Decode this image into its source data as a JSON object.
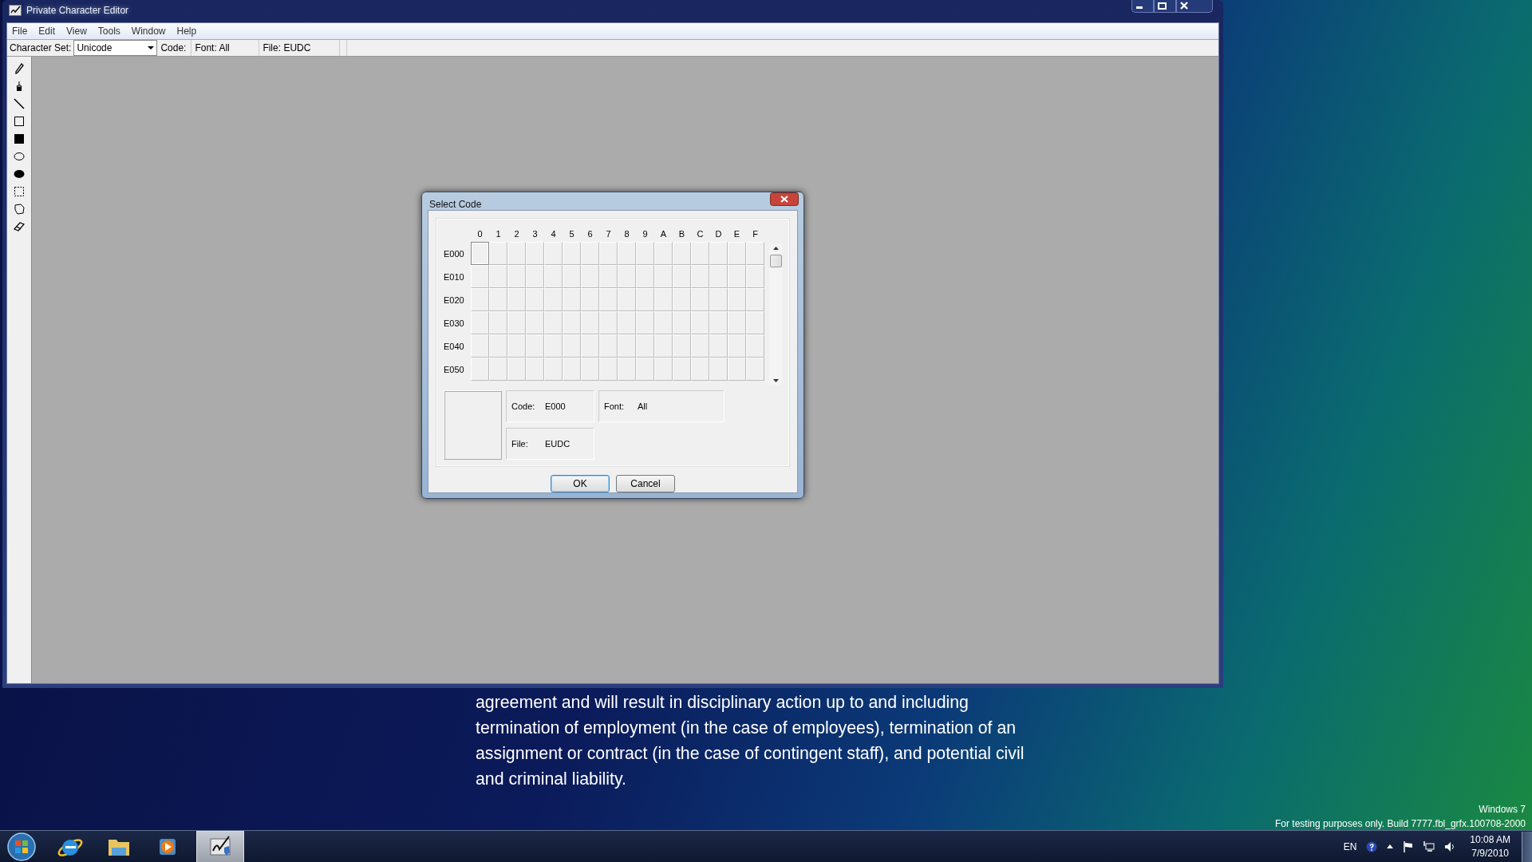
{
  "window": {
    "title": "Private Character Editor",
    "controls": [
      {
        "kind": "minimize"
      },
      {
        "kind": "maximize"
      },
      {
        "kind": "close"
      }
    ]
  },
  "menu": [
    "File",
    "Edit",
    "View",
    "Tools",
    "Window",
    "Help"
  ],
  "toolbar": {
    "charset_label": "Character Set:",
    "charset_value": "Unicode",
    "code": "Code:",
    "font": "Font: All",
    "file": "File: EUDC"
  },
  "tools": [
    {
      "kind": "pencil"
    },
    {
      "kind": "brush"
    },
    {
      "kind": "line"
    },
    {
      "kind": "rect"
    },
    {
      "kind": "filled-rect"
    },
    {
      "kind": "ellipse"
    },
    {
      "kind": "filled-ellipse"
    },
    {
      "kind": "rect-select"
    },
    {
      "kind": "free-select"
    },
    {
      "kind": "eraser"
    }
  ],
  "dialog": {
    "title": "Select Code",
    "columns": [
      "0",
      "1",
      "2",
      "3",
      "4",
      "5",
      "6",
      "7",
      "8",
      "9",
      "A",
      "B",
      "C",
      "D",
      "E",
      "F"
    ],
    "rows": [
      {
        "label": "E000",
        "cells": [
          {
            "selected": true
          },
          {
            "selected": false
          },
          {
            "selected": false
          },
          {
            "selected": false
          },
          {
            "selected": false
          },
          {
            "selected": false
          },
          {
            "selected": false
          },
          {
            "selected": false
          },
          {
            "selected": false
          },
          {
            "selected": false
          },
          {
            "selected": false
          },
          {
            "selected": false
          },
          {
            "selected": false
          },
          {
            "selected": false
          },
          {
            "selected": false
          },
          {
            "selected": false
          }
        ]
      },
      {
        "label": "E010",
        "cells": [
          {
            "selected": false
          },
          {
            "selected": false
          },
          {
            "selected": false
          },
          {
            "selected": false
          },
          {
            "selected": false
          },
          {
            "selected": false
          },
          {
            "selected": false
          },
          {
            "selected": false
          },
          {
            "selected": false
          },
          {
            "selected": false
          },
          {
            "selected": false
          },
          {
            "selected": false
          },
          {
            "selected": false
          },
          {
            "selected": false
          },
          {
            "selected": false
          },
          {
            "selected": false
          }
        ]
      },
      {
        "label": "E020",
        "cells": [
          {
            "selected": false
          },
          {
            "selected": false
          },
          {
            "selected": false
          },
          {
            "selected": false
          },
          {
            "selected": false
          },
          {
            "selected": false
          },
          {
            "selected": false
          },
          {
            "selected": false
          },
          {
            "selected": false
          },
          {
            "selected": false
          },
          {
            "selected": false
          },
          {
            "selected": false
          },
          {
            "selected": false
          },
          {
            "selected": false
          },
          {
            "selected": false
          },
          {
            "selected": false
          }
        ]
      },
      {
        "label": "E030",
        "cells": [
          {
            "selected": false
          },
          {
            "selected": false
          },
          {
            "selected": false
          },
          {
            "selected": false
          },
          {
            "selected": false
          },
          {
            "selected": false
          },
          {
            "selected": false
          },
          {
            "selected": false
          },
          {
            "selected": false
          },
          {
            "selected": false
          },
          {
            "selected": false
          },
          {
            "selected": false
          },
          {
            "selected": false
          },
          {
            "selected": false
          },
          {
            "selected": false
          },
          {
            "selected": false
          }
        ]
      },
      {
        "label": "E040",
        "cells": [
          {
            "selected": false
          },
          {
            "selected": false
          },
          {
            "selected": false
          },
          {
            "selected": false
          },
          {
            "selected": false
          },
          {
            "selected": false
          },
          {
            "selected": false
          },
          {
            "selected": false
          },
          {
            "selected": false
          },
          {
            "selected": false
          },
          {
            "selected": false
          },
          {
            "selected": false
          },
          {
            "selected": false
          },
          {
            "selected": false
          },
          {
            "selected": false
          },
          {
            "selected": false
          }
        ]
      },
      {
        "label": "E050",
        "cells": [
          {
            "selected": false
          },
          {
            "selected": false
          },
          {
            "selected": false
          },
          {
            "selected": false
          },
          {
            "selected": false
          },
          {
            "selected": false
          },
          {
            "selected": false
          },
          {
            "selected": false
          },
          {
            "selected": false
          },
          {
            "selected": false
          },
          {
            "selected": false
          },
          {
            "selected": false
          },
          {
            "selected": false
          },
          {
            "selected": false
          },
          {
            "selected": false
          },
          {
            "selected": false
          }
        ]
      }
    ],
    "code_label": "Code:",
    "code_value": "E000",
    "font_label": "Font:",
    "font_value": "All",
    "file_label": "File:",
    "file_value": "EUDC",
    "buttons": [
      {
        "label": "OK",
        "default": true
      },
      {
        "label": "Cancel",
        "default": false
      }
    ]
  },
  "caption_lines": [
    "agreement and will result in disciplinary action up to and including",
    "termination of employment (in the case of employees), termination of an",
    "assignment or contract (in the case of contingent staff), and potential civil",
    "and criminal liability."
  ],
  "build_info": [
    "Windows 7",
    "For testing purposes only. Build 7777.fbl_grfx.100708-2000"
  ],
  "taskbar": {
    "items": [
      {
        "kind": "start",
        "active": false
      },
      {
        "kind": "browser",
        "active": false
      },
      {
        "kind": "folder",
        "active": false
      },
      {
        "kind": "media",
        "active": false
      },
      {
        "kind": "editor",
        "active": true
      }
    ],
    "language": "EN",
    "time": "10:08 AM",
    "date": "7/9/2010"
  }
}
